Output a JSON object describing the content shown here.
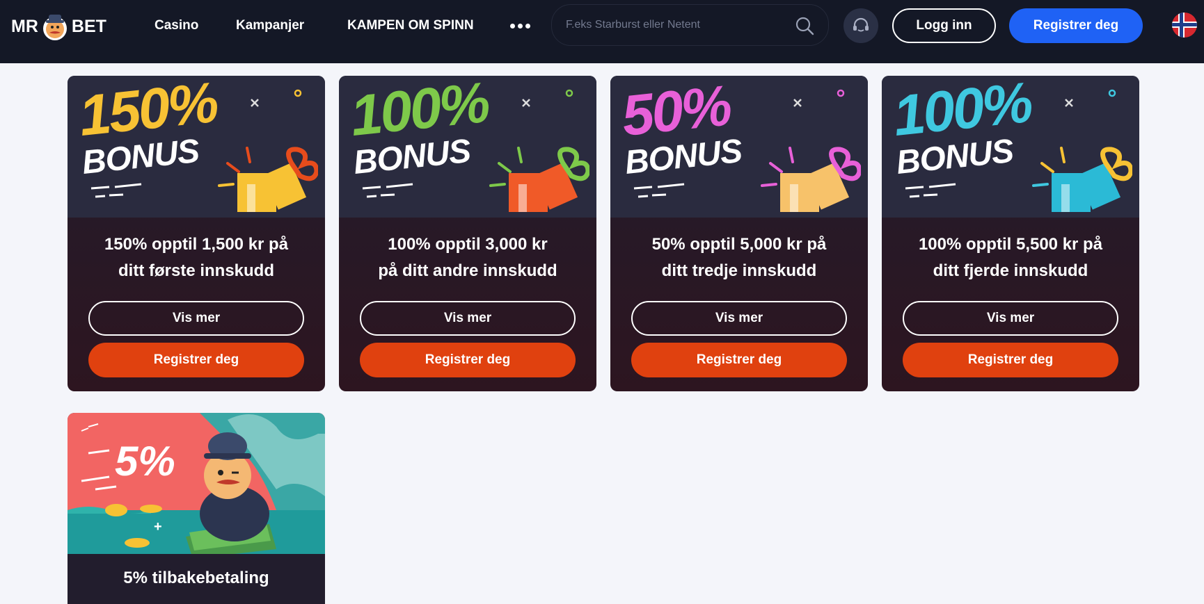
{
  "header": {
    "logo": {
      "left": "MR",
      "right": "BET"
    },
    "nav": [
      "Casino",
      "Kampanjer",
      "KAMPEN OM SPINN"
    ],
    "search_placeholder": "F.eks Starburst eller Netent",
    "login_label": "Logg inn",
    "register_label": "Registrer deg",
    "language": "Norwegian flag"
  },
  "cards": [
    {
      "percent": "150%",
      "bonus": "BONUS",
      "title_line1": "150% opptil 1,500 kr på",
      "title_line2": "ditt første innskudd",
      "more_label": "Vis mer",
      "register_label": "Registrer deg",
      "percent_color": "#f7c234",
      "gift_color": "#f7c234",
      "ribbon_color": "#e74c1c"
    },
    {
      "percent": "100%",
      "bonus": "BONUS",
      "title_line1": "100% opptil 3,000 kr",
      "title_line2": "på ditt andre innskudd",
      "more_label": "Vis mer",
      "register_label": "Registrer deg",
      "percent_color": "#7ec94a",
      "gift_color": "#f05a28",
      "ribbon_color": "#7ec94a"
    },
    {
      "percent": "50%",
      "bonus": "BONUS",
      "title_line1": "50% opptil 5,000 kr på",
      "title_line2": "ditt tredje innskudd",
      "more_label": "Vis mer",
      "register_label": "Registrer deg",
      "percent_color": "#e860d8",
      "gift_color": "#f7c26a",
      "ribbon_color": "#e860d8"
    },
    {
      "percent": "100%",
      "bonus": "BONUS",
      "title_line1": "100% opptil 5,500 kr på",
      "title_line2": "ditt fjerde innskudd",
      "more_label": "Vis mer",
      "register_label": "Registrer deg",
      "percent_color": "#3fc8e0",
      "gift_color": "#2bbad6",
      "ribbon_color": "#f7c234"
    }
  ],
  "cashback": {
    "percent": "5%",
    "title": "5% tilbakebetaling"
  }
}
